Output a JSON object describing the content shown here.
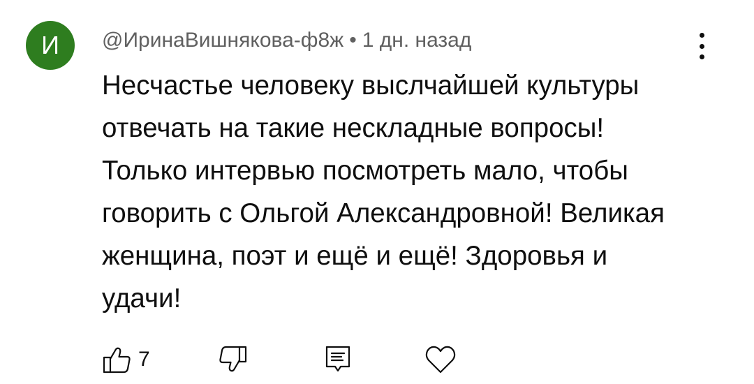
{
  "comment": {
    "avatar_letter": "И",
    "avatar_color": "#2e7d1f",
    "author": "@ИринаВишнякова-ф8ж",
    "separator": "•",
    "time": "1 дн. назад",
    "text": "Несчастье человеку выслчайшей культуры отвечать на такие нескладные вопросы! Только интервью посмотреть мало, чтобы говорить с Ольгой Александровной! Великая женщина, поэт и ещё и ещё! Здоровья и удачи!",
    "like_count": "7"
  },
  "icons": {
    "menu": "more-vertical-icon",
    "like": "thumbs-up-icon",
    "dislike": "thumbs-down-icon",
    "reply": "reply-comment-icon",
    "heart": "heart-icon"
  }
}
